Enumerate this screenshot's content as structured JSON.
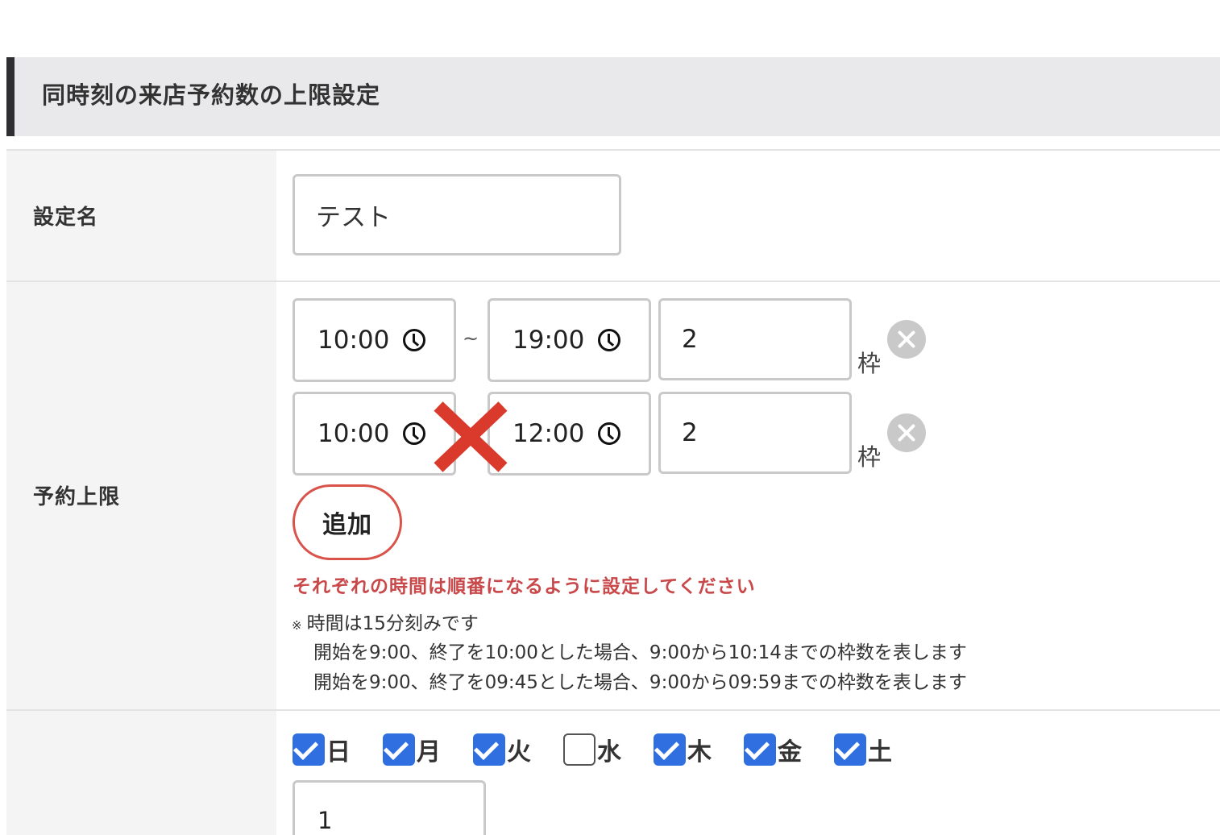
{
  "section": {
    "title": "同時刻の来店予約数の上限設定"
  },
  "fields": {
    "setting_name": {
      "label": "設定名",
      "value": "テスト"
    },
    "reservation_limit": {
      "label": "予約上限",
      "separator": "~",
      "unit": "枠",
      "rows": [
        {
          "start": "10:00",
          "end": "19:00",
          "count": "2"
        },
        {
          "start": "10:00",
          "end": "12:00",
          "count": "2"
        }
      ],
      "add_label": "追加",
      "error": "それぞれの時間は順番になるように設定してください",
      "note_mark": "※",
      "notes": [
        "時間は15分刻みです",
        "開始を9:00、終了を10:00とした場合、9:00から10:14までの枠数を表します",
        "開始を9:00、終了を09:45とした場合、9:00から09:59までの枠数を表します"
      ]
    },
    "weekdays": [
      {
        "label": "日",
        "checked": true
      },
      {
        "label": "月",
        "checked": true
      },
      {
        "label": "火",
        "checked": true
      },
      {
        "label": "水",
        "checked": false
      },
      {
        "label": "木",
        "checked": true
      },
      {
        "label": "金",
        "checked": true
      },
      {
        "label": "土",
        "checked": true
      }
    ],
    "weekday_count": {
      "value": "1"
    }
  },
  "colors": {
    "checkbox": "#2f6fe0",
    "error": "#c9484a",
    "add_border": "#d9534a",
    "error_mark": "#d93a2b"
  }
}
